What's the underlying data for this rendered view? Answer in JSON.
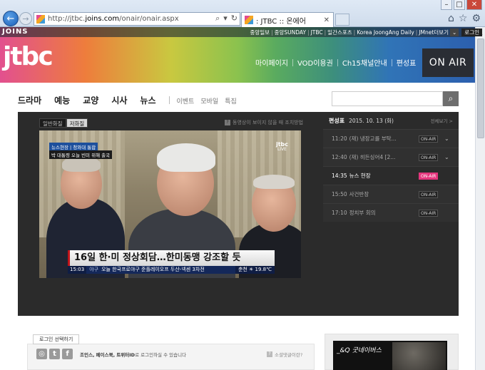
{
  "browser": {
    "url_prefix": "http://jtbc.",
    "url_domain": "joins.com",
    "url_path": "/onair/onair.aspx",
    "tab_title": ": JTBC :: 온에어",
    "back_icon": "back-arrow-icon",
    "forward_icon": "forward-arrow-icon",
    "toolbar_icons": [
      "home-icon",
      "star-icon",
      "gear-icon"
    ]
  },
  "header": {
    "network_label": "JOINS",
    "top_links": [
      "중앙일보",
      "중앙SUNDAY",
      "JTBC",
      "일간스포츠",
      "Korea JoongAng Daily",
      "JMnet더보기"
    ],
    "login_label": "로그인",
    "logo_text": "jtbc",
    "main_nav": [
      "마이페이지",
      "VOD이용권",
      "Ch15채널안내",
      "편성표"
    ],
    "onair_label": "ON AIR"
  },
  "category_nav": {
    "primary": [
      "드라마",
      "예능",
      "교양",
      "시사",
      "뉴스"
    ],
    "secondary": [
      "이벤트",
      "모바일",
      "특집"
    ]
  },
  "player": {
    "quality_tabs": [
      "일반화질",
      "저화질"
    ],
    "active_quality": "저화질",
    "help_text": "동영상이 보이지 않을 때 조치방법",
    "video": {
      "news_tag": "뉴스현장 | 청와대 통합",
      "news_sub": "박 대통령 오늘 빈미 위해 출국",
      "watermark": "jtbc",
      "watermark_sub": "LIVE",
      "caption": "16일 한·미 정상회담…한미동맹 강조할 듯",
      "ticker_time": "15:03",
      "ticker_category": "야구",
      "ticker_text": "오늘 한국프로야구 준플레이오프 두산-넥센 3차전",
      "ticker_weather": "춘천 ☀ 19.8℃"
    }
  },
  "schedule": {
    "title": "편성표",
    "date": "2015. 10. 13 (화)",
    "all_label": "전체보기 >",
    "items": [
      {
        "time": "11:20",
        "program": "(재) 냉장고를 부탁...",
        "badge": "ON-AIR",
        "live": false,
        "expand": true
      },
      {
        "time": "12:40",
        "program": "(재) 히든싱어4 [2...",
        "badge": "ON-AIR",
        "live": false,
        "expand": true
      },
      {
        "time": "14:35",
        "program": "뉴스 현장",
        "badge": "ON-AIR",
        "live": true,
        "expand": false
      },
      {
        "time": "15:50",
        "program": "사건반장",
        "badge": "ON-AIR",
        "live": false,
        "expand": false
      },
      {
        "time": "17:10",
        "program": "정치부 회의",
        "badge": "ON-AIR",
        "live": false,
        "expand": false
      }
    ]
  },
  "comments": {
    "login_tip": "로그인 선택하기",
    "sns_icons": [
      "joins-icon",
      "twitter-icon",
      "facebook-icon"
    ],
    "sns_text_bold": "조인스, 페이스북, 트위터ID",
    "sns_text": "로 로그인하실 수 있습니다",
    "social_help": "소셜댓글이란?"
  },
  "ad": {
    "text": "_&Q 굿네이버스"
  },
  "colors": {
    "onair_bg": "#2a2d34",
    "live_badge": "#e5367d",
    "player_bg": "#2b2b2b"
  }
}
